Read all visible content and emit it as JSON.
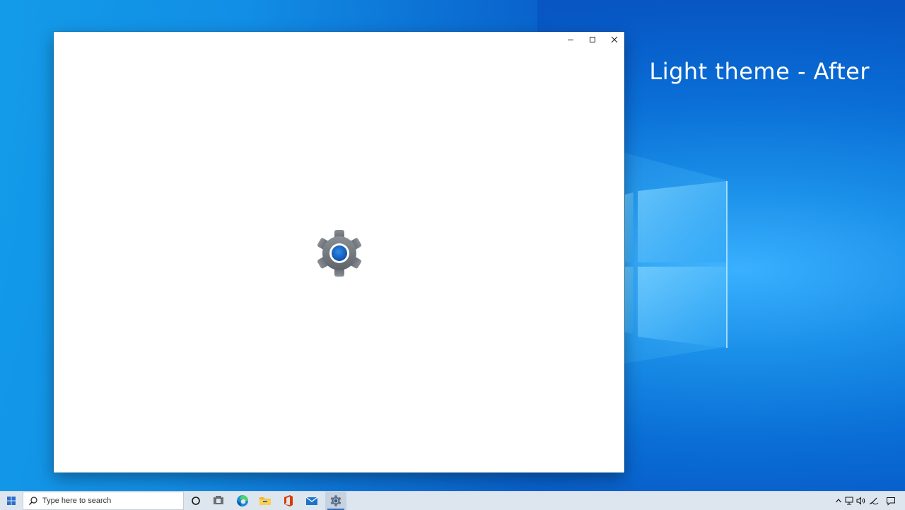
{
  "overlay": {
    "caption": "Light theme - After"
  },
  "window": {
    "controls": {
      "minimize_icon": "minimize-icon",
      "maximize_icon": "maximize-icon",
      "close_icon": "close-icon"
    },
    "splash_icon": "settings-gear-icon"
  },
  "taskbar": {
    "search": {
      "placeholder": "Type here to search"
    },
    "pinned_apps": [
      {
        "name": "Cortana",
        "icon": "cortana-icon"
      },
      {
        "name": "Task View",
        "icon": "task-view-icon"
      },
      {
        "name": "Microsoft Edge",
        "icon": "edge-icon"
      },
      {
        "name": "File Explorer",
        "icon": "folder-icon"
      },
      {
        "name": "Office",
        "icon": "office-icon"
      },
      {
        "name": "Mail",
        "icon": "mail-icon"
      },
      {
        "name": "Settings",
        "icon": "settings-icon",
        "active": true
      }
    ],
    "tray": [
      "chevron-up-icon",
      "network-icon",
      "volume-icon",
      "pen-icon",
      "notification-icon"
    ]
  },
  "colors": {
    "accent": "#2a6fc9",
    "gear_gray": "#737880",
    "gear_center": "#1565c0",
    "taskbar_bg": "#dde6ef"
  }
}
